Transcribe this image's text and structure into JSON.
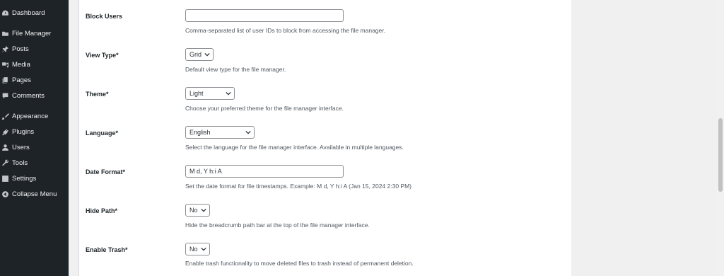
{
  "sidebar": {
    "items": [
      {
        "label": "Dashboard",
        "icon": "dashboard-icon"
      },
      {
        "label": "File Manager",
        "icon": "folder-icon"
      },
      {
        "label": "Posts",
        "icon": "pin-icon"
      },
      {
        "label": "Media",
        "icon": "media-icon"
      },
      {
        "label": "Pages",
        "icon": "pages-icon"
      },
      {
        "label": "Comments",
        "icon": "comment-icon"
      },
      {
        "label": "Appearance",
        "icon": "brush-icon"
      },
      {
        "label": "Plugins",
        "icon": "plugin-icon"
      },
      {
        "label": "Users",
        "icon": "user-icon"
      },
      {
        "label": "Tools",
        "icon": "wrench-icon"
      },
      {
        "label": "Settings",
        "icon": "settings-icon"
      },
      {
        "label": "Collapse Menu",
        "icon": "collapse-icon"
      }
    ]
  },
  "settings": {
    "block_users": {
      "label": "Block Users",
      "value": "",
      "description": "Comma-separated list of user IDs to block from accessing the file manager."
    },
    "view_type": {
      "label": "View Type*",
      "value": "Grid",
      "description": "Default view type for the file manager."
    },
    "theme": {
      "label": "Theme*",
      "value": "Light",
      "description": "Choose your preferred theme for the file manager interface."
    },
    "language": {
      "label": "Language*",
      "value": "English",
      "description": "Select the language for the file manager interface. Available in multiple languages."
    },
    "date_format": {
      "label": "Date Format*",
      "value": "M d, Y h:i A",
      "description": "Set the date format for file timestamps. Example: M d, Y h:i A (Jan 15, 2024 2:30 PM)"
    },
    "hide_path": {
      "label": "Hide Path*",
      "value": "No",
      "description": "Hide the breadcrumb path bar at the top of the file manager interface."
    },
    "enable_trash": {
      "label": "Enable Trash*",
      "value": "No",
      "description": "Enable trash functionality to move deleted files to trash instead of permanent deletion."
    }
  },
  "colors": {
    "sidebar_bg": "#1d2327",
    "content_bg": "#ffffff",
    "page_bg": "#f0f0f1"
  }
}
